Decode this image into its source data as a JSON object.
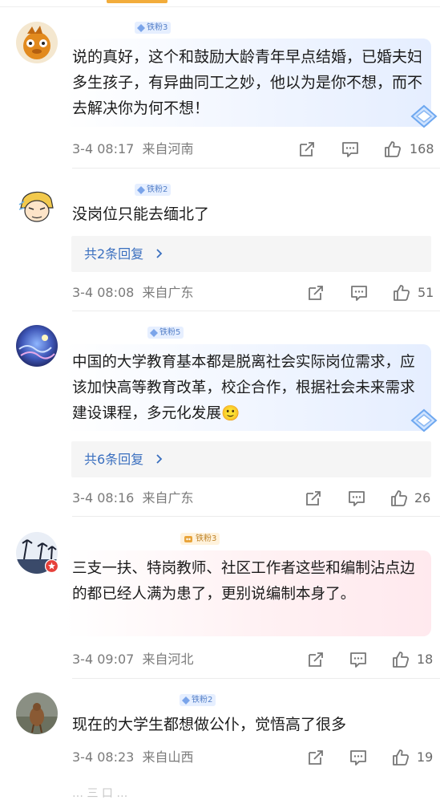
{
  "comments": [
    {
      "badge": "铁粉3",
      "text": "说的真好，这个和鼓励大龄青年早点结婚，已婚夫妇多生孩子，有异曲同工之妙，他以为是你不想，而不去解决你为何不想！",
      "time": "3-4 08:17",
      "location": "来自河南",
      "likes": "168"
    },
    {
      "badge": "铁粉2",
      "text": "没岗位只能去缅北了",
      "replies": "共2条回复",
      "time": "3-4 08:08",
      "location": "来自广东",
      "likes": "51"
    },
    {
      "badge": "铁粉5",
      "text": "中国的大学教育基本都是脱离社会实际岗位需求，应该加快高等教育改革，校企合作，根据社会未来需求建设课程，多元化发展",
      "emoji": "🙂",
      "replies": "共6条回复",
      "time": "3-4 08:16",
      "location": "来自广东",
      "likes": "26"
    },
    {
      "badge": "铁粉3",
      "text": "三支一扶、特岗教师、社区工作者这些和编制沾点边的都已经人满为患了，更别说编制本身了。",
      "time": "3-4 09:07",
      "location": "来自河北",
      "likes": "18"
    },
    {
      "badge": "铁粉2",
      "text": "现在的大学生都想做公仆，觉悟高了很多",
      "time": "3-4 08:23",
      "location": "来自山西",
      "likes": "19"
    }
  ],
  "next_peek": "… 三 口 …",
  "colors": {
    "accent": "#f2ac3b",
    "badge_blue": "#5580c8",
    "replies_link": "#3a6fbf",
    "meta_gray": "#7a7a7a"
  },
  "icons": [
    "repost-icon",
    "comment-icon",
    "like-icon",
    "chevron-right-icon",
    "diamond-decoration-icon",
    "gem-icon",
    "avatar-badge-icon"
  ]
}
